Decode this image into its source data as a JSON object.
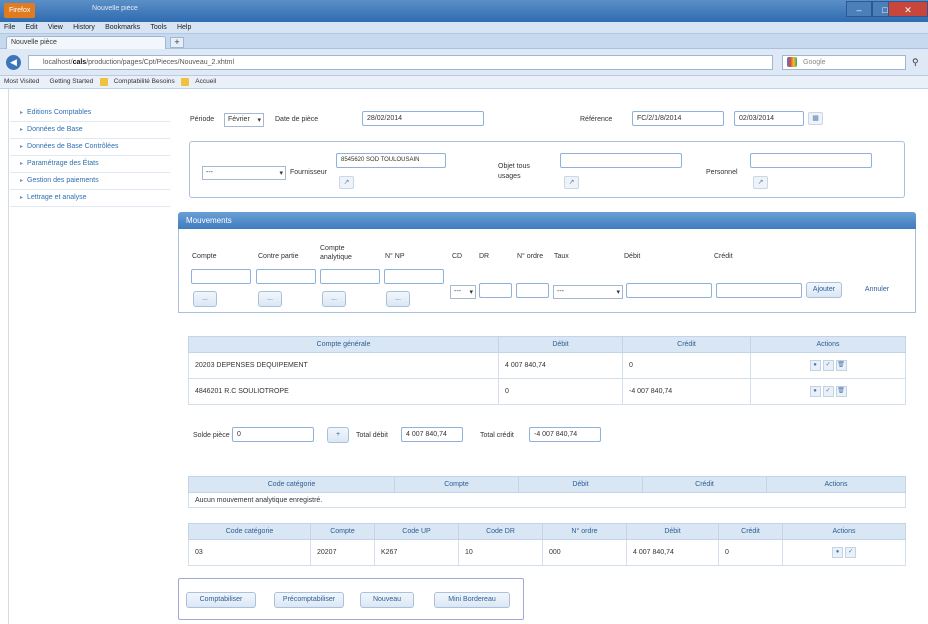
{
  "window": {
    "tab_title": "Nouvelle pièce",
    "badge": "Firefox",
    "title": "Nouvelle pièce",
    "menu": [
      "File",
      "Edit",
      "View",
      "History",
      "Bookmarks",
      "Tools",
      "Help"
    ]
  },
  "nav": {
    "url_prefix": "localhost/",
    "url_host": "cals",
    "url_rest": "/production/pages/Cpt/Pieces/Nouveau_2.xhtml",
    "search_placeholder": "Google"
  },
  "bookmarks": [
    "Most Visited",
    "Getting Started",
    "Comptabilité Besoins",
    "Accueil"
  ],
  "sidebar": {
    "items": [
      "Editions Comptables",
      "Données de Base",
      "Données de Base Contrôlées",
      "Paramétrage des États",
      "Gestion des paiements",
      "Lettrage et analyse"
    ]
  },
  "form": {
    "periode_label": "Période",
    "periode_value": "Février",
    "date_label": "Date de pièce",
    "date_value": "28/02/2014",
    "reference_label": "Référence",
    "reference_value": "FC/2/1/8/2014",
    "reference_date": "02/03/2014",
    "fournisseur_label": "Fournisseur",
    "fournisseur_select": "---",
    "fournisseur_value": "8545620  SOD TOULOUSAIN",
    "objet_label": "Objet tous usages",
    "personnel_label": "Personnel"
  },
  "mouvements": {
    "header": "Mouvements",
    "col_compte": "Compte",
    "col_contrepartie": "Contre partie",
    "col_analytique": "Compte analytique",
    "col_np": "N° NP",
    "col_cd": "CD",
    "col_dr": "DR",
    "col_numordre": "N° ordre",
    "col_taux": "Taux",
    "col_debit": "Débit",
    "col_credit": "Crédit",
    "dots": "...",
    "select_blank": "---",
    "ajouter": "Ajouter",
    "annuler": "Annuler"
  },
  "general_table": {
    "headers": [
      "Compte générale",
      "Débit",
      "Crédit",
      "Actions"
    ],
    "rows": [
      {
        "compte": "20203  DEPENSES DEQUIPEMENT",
        "debit": "4 007 840,74",
        "credit": "0"
      },
      {
        "compte": "4846201  R.C SOULIOTROPE",
        "debit": "0",
        "credit": "-4 007 840,74"
      }
    ]
  },
  "soldes": {
    "solde_label": "Solde pièce",
    "solde_value": "0",
    "plus": "+",
    "total_debit_label": "Total débit",
    "total_debit_value": "4 007 840,74",
    "total_credit_label": "Total crédit",
    "total_credit_value": "-4 007 840,74"
  },
  "analytique_table": {
    "headers": [
      "Code catégorie",
      "Compte",
      "Débit",
      "Crédit",
      "Actions"
    ],
    "empty": "Aucun mouvement analytique enregistré."
  },
  "detail_table": {
    "headers": [
      "Code catégorie",
      "Compte",
      "Code UP",
      "Code DR",
      "N° ordre",
      "Débit",
      "Crédit",
      "Actions"
    ],
    "row": {
      "cat": "03",
      "compte": "20207",
      "up": "K267",
      "dr": "10",
      "ordre": "000",
      "debit": "4 007 840,74",
      "credit": "0"
    }
  },
  "footer": {
    "buttons": [
      "Comptabiliser",
      "Précomptabiliser",
      "Nouveau",
      "Mini Bordereau"
    ]
  },
  "colors": {
    "accent": "#3f7cbf",
    "border": "#a8c1df"
  }
}
